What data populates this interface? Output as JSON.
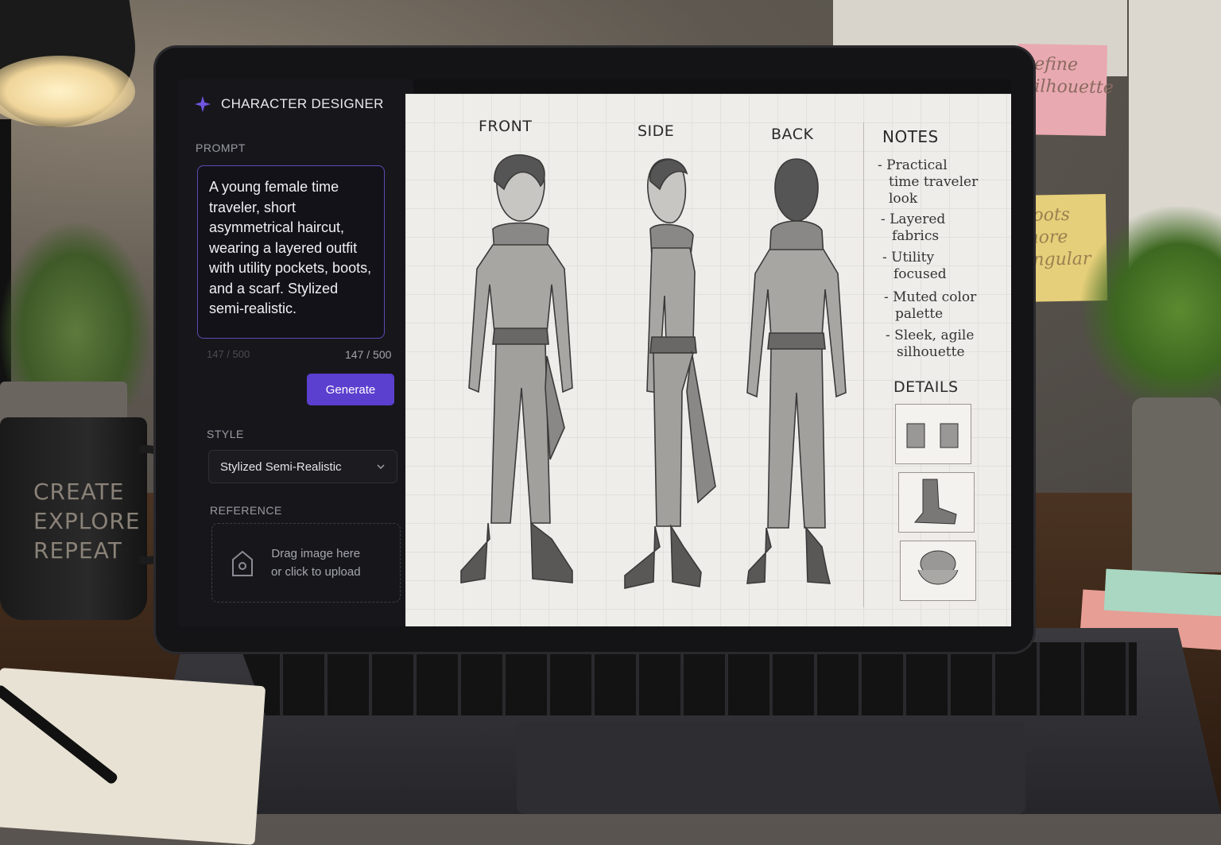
{
  "app": {
    "title": "CHARACTER DESIGNER"
  },
  "prompt": {
    "label": "PROMPT",
    "text": "A young female time traveler, short asymmetrical haircut, wearing a layered outfit with utility pockets, boots, and a scarf. Stylized semi-realistic.",
    "counter_ghost": "147 / 500",
    "counter": "147 / 500"
  },
  "generate_button": {
    "label": "Generate"
  },
  "style": {
    "label": "STYLE",
    "selected": "Stylized Semi-Realistic"
  },
  "reference": {
    "label": "REFERENCE",
    "line1": "Drag image here",
    "line2": "or click to upload"
  },
  "sheet": {
    "views": [
      "FRONT",
      "SIDE",
      "BACK"
    ],
    "notes_title": "NOTES",
    "notes": [
      [
        "- Practical",
        "time traveler",
        "look"
      ],
      [
        "- Layered",
        "fabrics"
      ],
      [
        "- Utility",
        "focused"
      ],
      [
        "- Muted color",
        "palette"
      ],
      [
        "- Sleek, agile",
        "silhouette"
      ]
    ],
    "details_title": "DETAILS"
  },
  "environment": {
    "mug_text": [
      "CREATE",
      "EXPLORE",
      "REPEAT"
    ],
    "sticky_pink": [
      "refine",
      "silhouette"
    ],
    "sticky_yellow": [
      "boots",
      "more",
      "angular"
    ]
  },
  "colors": {
    "accent": "#5b3fcf",
    "sidebar_bg": "#17171b",
    "canvas_bg": "#efedea"
  }
}
